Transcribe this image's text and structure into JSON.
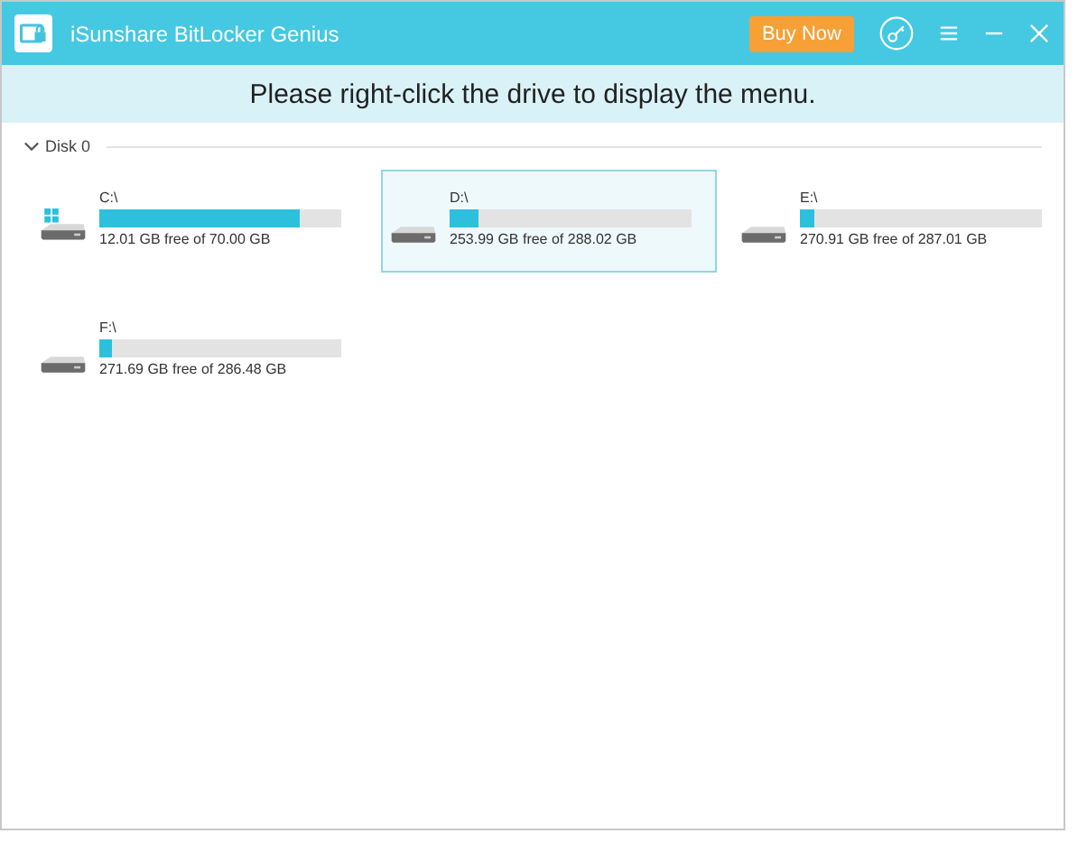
{
  "window": {
    "title": "iSunshare BitLocker Genius",
    "buy_button": "Buy Now"
  },
  "banner": "Please right-click the drive to display the menu.",
  "disk": {
    "label": "Disk 0",
    "expanded": true,
    "drives": [
      {
        "name": "C:\\",
        "kind": "system",
        "level": 0.83,
        "usage": "12.01 GB free of 70.00 GB",
        "selected": false
      },
      {
        "name": "D:\\",
        "kind": "data",
        "level": 0.12,
        "usage": "253.99 GB free of 288.02 GB",
        "selected": true
      },
      {
        "name": "E:\\",
        "kind": "data",
        "level": 0.06,
        "usage": "270.91 GB free of 287.01 GB",
        "selected": false
      },
      {
        "name": "F:\\",
        "kind": "data",
        "level": 0.05,
        "usage": "271.69 GB free of 286.48 GB",
        "selected": false
      }
    ]
  }
}
